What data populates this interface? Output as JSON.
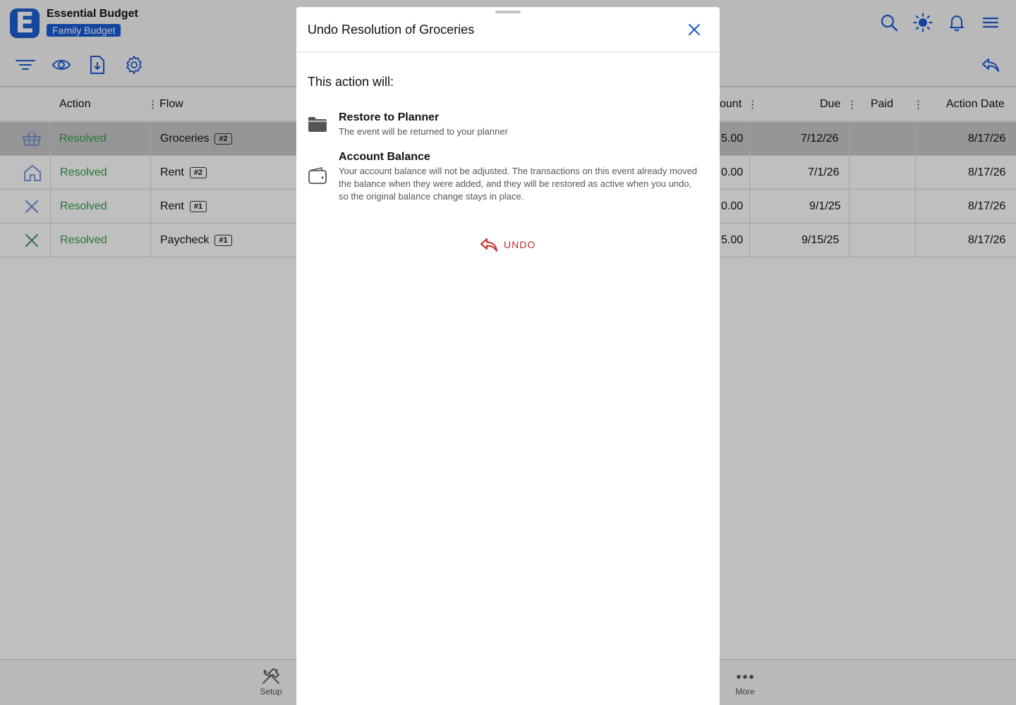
{
  "app": {
    "title": "Essential Budget",
    "budget_name": "Family Budget",
    "logo_letter": "E",
    "accent_color": "#1a5bd6"
  },
  "header_icons": [
    "search-icon",
    "brightness-icon",
    "bell-icon",
    "menu-icon"
  ],
  "toolbar_icons": [
    "filter-icon",
    "eye-icon",
    "download-file-icon",
    "gear-icon",
    "reply-icon"
  ],
  "table": {
    "columns": {
      "action": "Action",
      "flow": "Flow",
      "amount": "ount",
      "due": "Due",
      "paid": "Paid",
      "action_date": "Action Date"
    },
    "rows": [
      {
        "icon": "basket-icon",
        "status": "Resolved",
        "flow": "Groceries",
        "num": "#2",
        "amount": "5.00",
        "due": "7/12/26",
        "paid": "",
        "action_date": "8/17/26",
        "selected": true
      },
      {
        "icon": "home-icon",
        "status": "Resolved",
        "flow": "Rent",
        "num": "#2",
        "amount": "0.00",
        "due": "7/1/26",
        "paid": "",
        "action_date": "8/17/26",
        "selected": false
      },
      {
        "icon": "x-icon",
        "status": "Resolved",
        "flow": "Rent",
        "num": "#1",
        "amount": "0.00",
        "due": "9/1/25",
        "paid": "",
        "action_date": "8/17/26",
        "selected": false
      },
      {
        "icon": "x-green-icon",
        "status": "Resolved",
        "flow": "Paycheck",
        "num": "#1",
        "amount": "5.00",
        "due": "9/15/25",
        "paid": "",
        "action_date": "8/17/26",
        "selected": false
      }
    ]
  },
  "bottom_nav": {
    "setup": "Setup",
    "more": "More"
  },
  "modal": {
    "title": "Undo Resolution of Groceries",
    "lead": "This action will:",
    "items": [
      {
        "icon": "folder-icon",
        "title": "Restore to Planner",
        "desc": "The event will be returned to your planner"
      },
      {
        "icon": "wallet-icon",
        "title": "Account Balance",
        "desc": "Your account balance will not be adjusted. The transactions on this event already moved the balance when they were added, and they will be restored as active when you undo, so the original balance change stays in place."
      }
    ],
    "undo_label": "UNDO",
    "undo_color": "#c62828"
  }
}
